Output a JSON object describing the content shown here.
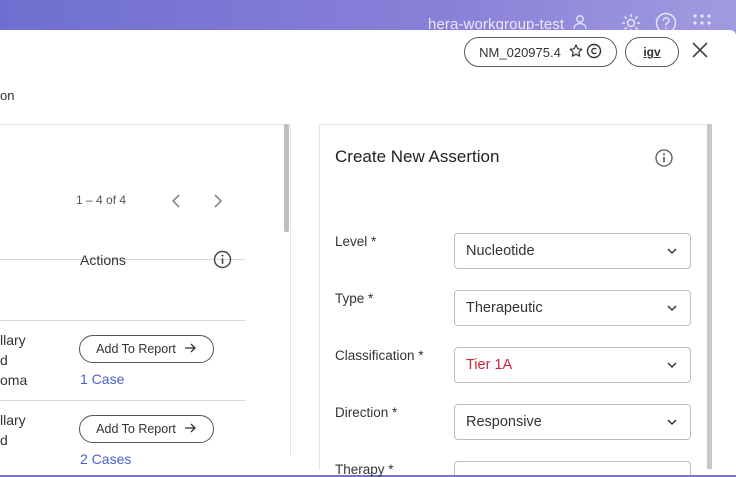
{
  "header": {
    "workgroup": "hera-workgroup-test"
  },
  "dialog": {
    "transcript_chip": "NM_020975.4",
    "igv_chip": "igv",
    "subtitle": "on"
  },
  "left_panel": {
    "pagination": "1 – 4 of 4",
    "actions_header": "Actions",
    "rows": [
      {
        "line1": "llary",
        "line2": "d",
        "line3": "oma",
        "button": "Add To Report",
        "link": "1 Case"
      },
      {
        "line1": "llary",
        "line2": "d",
        "line3": "",
        "button": "Add To Report",
        "link": "2 Cases"
      }
    ]
  },
  "assertion": {
    "title": "Create New Assertion",
    "fields": [
      {
        "label": "Level *",
        "value": "Nucleotide"
      },
      {
        "label": "Type *",
        "value": "Therapeutic"
      },
      {
        "label": "Classification *",
        "value": "Tier 1A"
      },
      {
        "label": "Direction *",
        "value": "Responsive"
      },
      {
        "label": "Therapy *",
        "value": ""
      }
    ],
    "classification_color": "#d0223b"
  }
}
